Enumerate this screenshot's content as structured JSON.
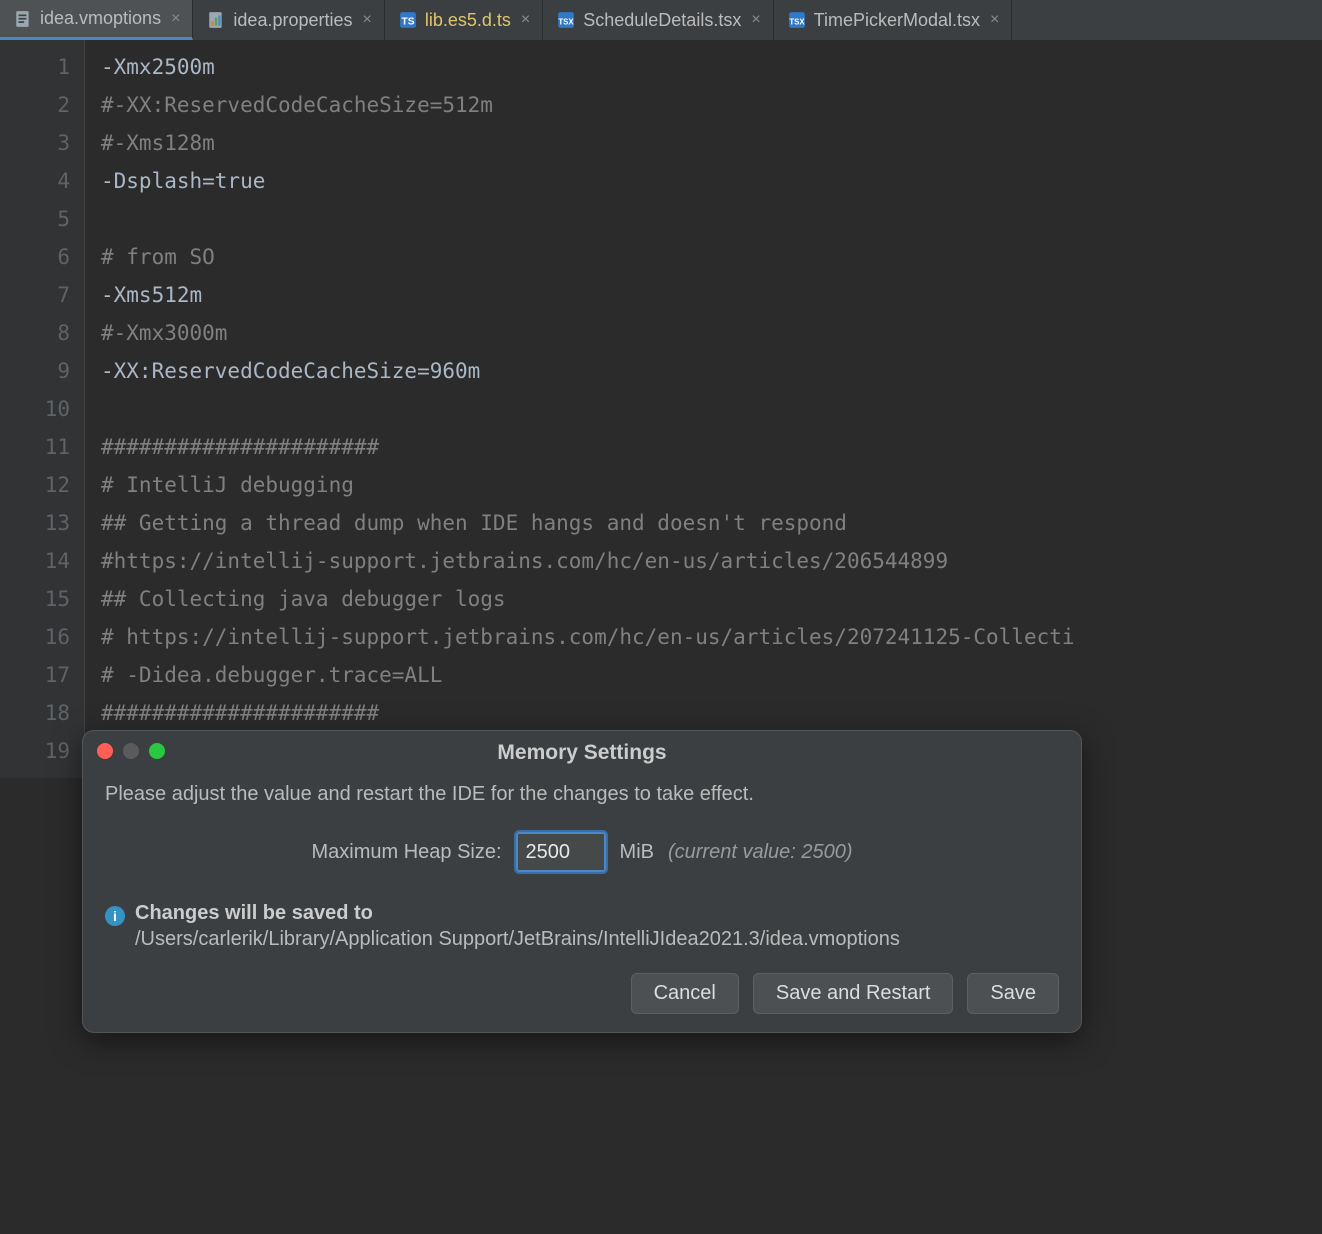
{
  "tabs": [
    {
      "label": "idea.vmoptions",
      "icon": "doc",
      "active": true,
      "highlighted": false
    },
    {
      "label": "idea.properties",
      "icon": "props",
      "active": false,
      "highlighted": false
    },
    {
      "label": "lib.es5.d.ts",
      "icon": "ts",
      "active": false,
      "highlighted": true
    },
    {
      "label": "ScheduleDetails.tsx",
      "icon": "tsx",
      "active": false,
      "highlighted": false
    },
    {
      "label": "TimePickerModal.tsx",
      "icon": "tsx",
      "active": false,
      "highlighted": false
    }
  ],
  "editor": {
    "lines": [
      {
        "n": 1,
        "text": "-Xmx2500m",
        "comment": false
      },
      {
        "n": 2,
        "text": "#-XX:ReservedCodeCacheSize=512m",
        "comment": true
      },
      {
        "n": 3,
        "text": "#-Xms128m",
        "comment": true
      },
      {
        "n": 4,
        "text": "-Dsplash=true",
        "comment": false
      },
      {
        "n": 5,
        "text": "",
        "comment": false
      },
      {
        "n": 6,
        "text": "# from SO",
        "comment": true
      },
      {
        "n": 7,
        "text": "-Xms512m",
        "comment": false
      },
      {
        "n": 8,
        "text": "#-Xmx3000m",
        "comment": true
      },
      {
        "n": 9,
        "text": "-XX:ReservedCodeCacheSize=960m",
        "comment": false
      },
      {
        "n": 10,
        "text": "",
        "comment": false
      },
      {
        "n": 11,
        "text": "######################",
        "comment": true
      },
      {
        "n": 12,
        "text": "# IntelliJ debugging",
        "comment": true
      },
      {
        "n": 13,
        "text": "## Getting a thread dump when IDE hangs and doesn't respond",
        "comment": true
      },
      {
        "n": 14,
        "text": "#https://intellij-support.jetbrains.com/hc/en-us/articles/206544899",
        "comment": true
      },
      {
        "n": 15,
        "text": "## Collecting java debugger logs",
        "comment": true
      },
      {
        "n": 16,
        "text": "# https://intellij-support.jetbrains.com/hc/en-us/articles/207241125-Collecti",
        "comment": true
      },
      {
        "n": 17,
        "text": "# -Didea.debugger.trace=ALL",
        "comment": true
      },
      {
        "n": 18,
        "text": "######################",
        "comment": true
      },
      {
        "n": 19,
        "text": "",
        "comment": false
      }
    ]
  },
  "dialog": {
    "title": "Memory Settings",
    "intro": "Please adjust the value and restart the IDE for the changes to take effect.",
    "heap_label": "Maximum Heap Size:",
    "heap_value": "2500",
    "heap_unit": "MiB",
    "current_label": "(current value: 2500)",
    "info_title": "Changes will be saved to",
    "info_path": "/Users/carlerik/Library/Application Support/JetBrains/IntelliJIdea2021.3/idea.vmoptions",
    "buttons": {
      "cancel": "Cancel",
      "save_restart": "Save and Restart",
      "save": "Save"
    }
  }
}
